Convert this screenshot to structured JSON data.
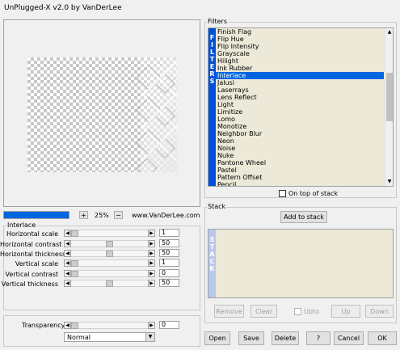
{
  "window": {
    "title": "UnPlugged-X v2.0 by VanDerLee"
  },
  "preview": {
    "zoom": "25%",
    "website": "www.VanDerLee.com",
    "progress_fraction": 1.0
  },
  "filters": {
    "label": "Filters",
    "side_letters": [
      "F",
      "I",
      "L",
      "T",
      "E",
      "R",
      "S"
    ],
    "items": [
      "Finish Flag",
      "Flip Hue",
      "Flip Intensity",
      "Grayscale",
      "Hilight",
      "Ink Rubber",
      "Interlace",
      "Jalusi",
      "Laserrays",
      "Lens Reflect",
      "Light",
      "Limitize",
      "Lomo",
      "Monotize",
      "Neighbor Blur",
      "Neon",
      "Noise",
      "Nuke",
      "Pantone Wheel",
      "Pastel",
      "Pattern Offset",
      "Pencil"
    ],
    "selected": "Interlace",
    "on_top_label": "On top of stack"
  },
  "interlace": {
    "label": "Interlace",
    "params": [
      {
        "label": "Horizontal scale",
        "value": "1",
        "fraction": 0.0
      },
      {
        "label": "Horizontal contrast",
        "value": "50",
        "fraction": 0.5
      },
      {
        "label": "Horizontal thickness",
        "value": "50",
        "fraction": 0.5
      },
      {
        "label": "Vertical scale",
        "value": "1",
        "fraction": 0.0
      },
      {
        "label": "Vertical contrast",
        "value": "0",
        "fraction": 0.0
      },
      {
        "label": "Vertical thickness",
        "value": "50",
        "fraction": 0.5
      }
    ]
  },
  "transparency": {
    "label": "Transparency",
    "value": "0",
    "fraction": 0.0
  },
  "blend": {
    "selected": "Normal"
  },
  "stack": {
    "label": "Stack",
    "add_label": "Add to stack",
    "side_letters": [
      "S",
      "T",
      "A",
      "C",
      "K"
    ],
    "remove_label": "Remove",
    "clear_label": "Clear",
    "upto_label": "Upto",
    "up_label": "Up",
    "down_label": "Down"
  },
  "buttons": {
    "open": "Open",
    "save": "Save",
    "delete": "Delete",
    "help": "?",
    "cancel": "Cancel",
    "ok": "OK"
  },
  "colors": {
    "accent": "#0066e0",
    "filter_strip": "#0050d8",
    "list_bg": "#ece9d8",
    "stack_strip": "#b8c8ec"
  }
}
